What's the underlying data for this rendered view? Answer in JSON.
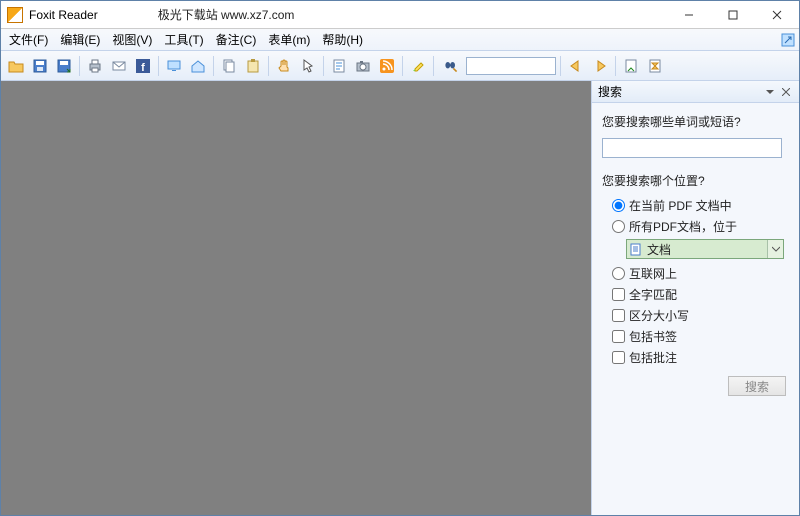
{
  "titlebar": {
    "app_name": "Foxit Reader",
    "subtitle": "极光下载站 www.xz7.com"
  },
  "menu": {
    "file": "文件(F)",
    "edit": "编辑(E)",
    "view": "视图(V)",
    "tool": "工具(T)",
    "comment": "备注(C)",
    "form": "表单(m)",
    "help": "帮助(H)"
  },
  "toolbar": {
    "search_input": ""
  },
  "sidepanel": {
    "title": "搜索",
    "question1": "您要搜索哪些单词或短语?",
    "search_value": "",
    "question2": "您要搜索哪个位置?",
    "opt_current": "在当前 PDF 文档中",
    "opt_all": "所有PDF文档，位于",
    "folder_label": "文档",
    "opt_internet": "互联网上",
    "opt_wholeword": "全字匹配",
    "opt_case": "区分大小写",
    "opt_bookmarks": "包括书签",
    "opt_annotations": "包括批注",
    "button_label": "搜索"
  }
}
